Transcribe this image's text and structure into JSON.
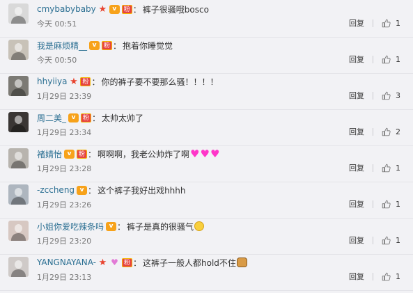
{
  "comments": [
    {
      "username": "cmybabybaby",
      "badges": [
        "star",
        "vip",
        "fans"
      ],
      "text": "裤子很骚哦bosco",
      "emojis": [],
      "time": "今天 00:51",
      "reply_label": "回复",
      "likes": "1",
      "avatar_color": "#d9d9d9"
    },
    {
      "username": "我是麻烦精__",
      "badges": [
        "vip",
        "fans"
      ],
      "text": "抱着你睡觉觉",
      "emojis": [],
      "time": "今天 00:50",
      "reply_label": "回复",
      "likes": "1",
      "avatar_color": "#c8c2b8"
    },
    {
      "username": "hhyiiya",
      "badges": [
        "star",
        "fans"
      ],
      "text": "你的裤子要不要那么骚！！！！",
      "emojis": [],
      "time": "1月29日 23:39",
      "reply_label": "回复",
      "likes": "3",
      "avatar_color": "#7c7a74"
    },
    {
      "username": "周二美_",
      "badges": [
        "vip",
        "fans"
      ],
      "text": "太帅太帅了",
      "emojis": [],
      "time": "1月29日 23:34",
      "reply_label": "回复",
      "likes": "2",
      "avatar_color": "#3a3634"
    },
    {
      "username": "褚婧怡",
      "badges": [
        "vip",
        "fans"
      ],
      "text": "啊啊啊，我老公帅炸了啊",
      "emojis": [
        "heart",
        "heart",
        "heart"
      ],
      "time": "1月29日 23:28",
      "reply_label": "回复",
      "likes": "1",
      "avatar_color": "#b8b4ae"
    },
    {
      "username": "-zccheng",
      "badges": [
        "vip"
      ],
      "text": "这个裤子我好出戏hhhh",
      "emojis": [],
      "time": "1月29日 23:26",
      "reply_label": "回复",
      "likes": "1",
      "avatar_color": "#aeb6bf"
    },
    {
      "username": "小姐你爱吃辣条吗",
      "badges": [
        "vip"
      ],
      "text": "裤子是真的很骚气",
      "emojis": [
        "face"
      ],
      "time": "1月29日 23:20",
      "reply_label": "回复",
      "likes": "1",
      "avatar_color": "#d7c8c2"
    },
    {
      "username": "YANGNAYANA-",
      "badges": [
        "star",
        "bow",
        "fans"
      ],
      "text": "这裤子一般人都hold不住",
      "emojis": [
        "dog"
      ],
      "time": "1月29日 23:13",
      "reply_label": "回复",
      "likes": "1",
      "avatar_color": "#cfcac8"
    }
  ],
  "colors": {
    "username": "#2b6f92",
    "background": "#f2f2f5",
    "heart_emoji": "#ff36c9"
  }
}
